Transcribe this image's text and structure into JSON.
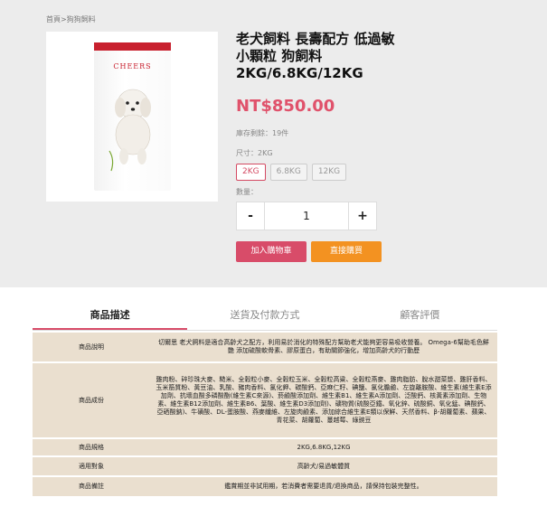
{
  "breadcrumb": "首頁>狗狗飼料",
  "product": {
    "brand_on_bag": "CHEERS",
    "title": "老犬飼料 長壽配方 低過敏 小顆粒 狗飼料 2KG/6.8KG/12KG",
    "price": "NT$850.00",
    "stock": "庫存剩餘：19件",
    "size_label": "尺寸：2KG",
    "sizes": [
      "2KG",
      "6.8KG",
      "12KG"
    ],
    "selected_size": "2KG",
    "qty_label": "數量：",
    "qty_minus": "-",
    "qty_value": "1",
    "qty_plus": "+",
    "add_to_cart": "加入購物車",
    "buy_now": "直接購買"
  },
  "tabs": [
    "商品描述",
    "送貨及付款方式",
    "顧客評價"
  ],
  "spec": [
    {
      "k": "商品說明",
      "v": "切爾思 老犬飼料是適合高齡犬之配方，利用易於消化的特殊配方幫助老犬能夠更容易吸收營養。 Omega-6幫助毛色鮮艷 添加硫酸軟骨素、膠原蛋白，有助關節強化，增加高齡犬的行動歷"
    },
    {
      "k": "商品成份",
      "v": "雞肉粉、碎珍珠大麥、糙米、全穀粒小麥、全穀粒玉米、全穀粒高粱、全穀粒燕麥、雞肉脂肪、脫水甜菜漿、雞肝香料、玉米筋質粉、黃豆油、乳酸、豬肉香料、氯化鉀、碳酸鈣、亞麻仁籽、碘鹽、氯化膽鹼、左旋離胺酸、維生素(維生素E添加劑、抗壞血酸多磷酸酯(維生素C來源)、菸鹼酸添加劑、維生素B1、維生素A添加劑、泛酸鈣、核黃素添加劑、生物素、維生素B12添加劑、維生素B6、葉酸、維生素D3添加劑)、礦物質(硫酸亞鐵、氧化鋅、硫酸銅、氧化錳、碘酸鈣、亞硒酸鈉)、牛磺酸、DL-蛋胺酸、燕麥纖維、左旋肉鹼素、添加綜合維生素E類以保鮮、天然香料、β-胡蘿蔔素、蘋果、青花菜、胡蘿蔔、蔓越莓、綠豌豆"
    },
    {
      "k": "商品規格",
      "v": "2KG,6.8KG,12KG"
    },
    {
      "k": "適用對象",
      "v": "高齡犬/易過敏體質"
    },
    {
      "k": "商品備註",
      "v": "鑑賞期並非試用期，若消費者需要退貨/退換商品，請保持包裝完整性。"
    }
  ]
}
